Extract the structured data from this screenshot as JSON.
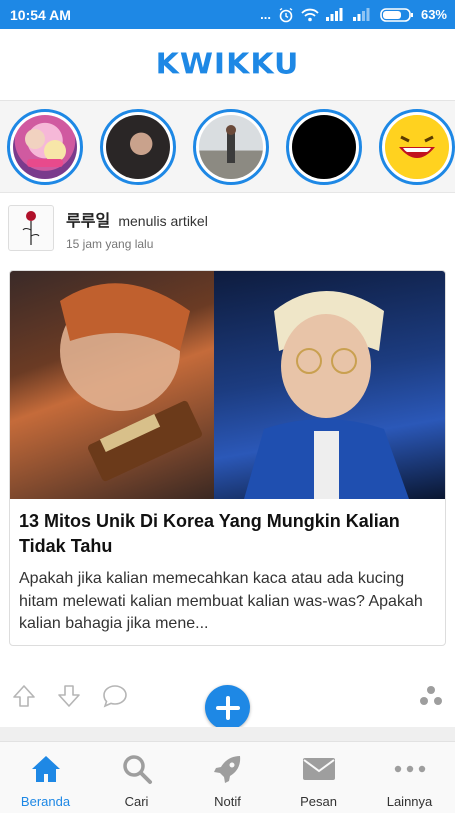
{
  "status_bar": {
    "time": "10:54 AM",
    "battery": "63%",
    "dots": "..."
  },
  "header": {
    "logo": "KWIKKU"
  },
  "stories": [
    {
      "name": "story-1"
    },
    {
      "name": "story-2"
    },
    {
      "name": "story-3"
    },
    {
      "name": "story-4"
    },
    {
      "name": "story-5"
    }
  ],
  "post": {
    "author": "루루일",
    "action": "menulis artikel",
    "time": "15 jam yang lalu",
    "title": "13 Mitos Unik Di Korea Yang Mungkin Kalian Tidak Tahu",
    "excerpt": " Apakah jika kalian memecahkan kaca atau ada kucing hitam melewati kalian membuat kalian was-was? Apakah kalian bahagia jika mene..."
  },
  "colors": {
    "brand": "#1e88e5",
    "icon_gray": "#9e9e9e"
  },
  "bottom_nav": {
    "home": "Beranda",
    "search": "Cari",
    "notif": "Notif",
    "messages": "Pesan",
    "more": "Lainnya"
  }
}
